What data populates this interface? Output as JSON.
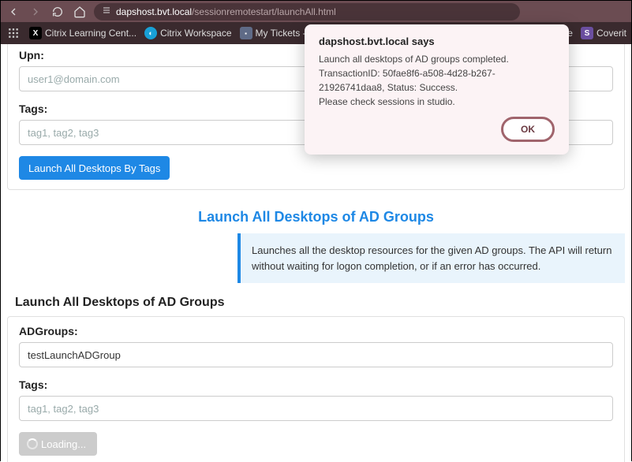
{
  "browser": {
    "url_domain": "dapshost.bvt.local",
    "url_path": "/sessionremotestart/launchAll.html"
  },
  "bookmarks": {
    "b1": "Citrix Learning Cent...",
    "b2": "Citrix Workspace",
    "b3": "My Tickets - Citrite...",
    "b4": "kstage",
    "b5": "Coverit"
  },
  "upn": {
    "label": "Upn:",
    "placeholder": "user1@domain.com"
  },
  "tags1": {
    "label": "Tags:",
    "placeholder": "tag1, tag2, tag3"
  },
  "btn_launch_tags": "Launch All Desktops By Tags",
  "section2_title": "Launch All Desktops of AD Groups",
  "section2_info": "Launches all the desktop resources for the given AD groups. The API will return without waiting for logon completion, or if an error has occurred.",
  "fieldset_title": "Launch All Desktops of AD Groups",
  "adgroups": {
    "label": "ADGroups:",
    "value": "testLaunchADGroup"
  },
  "tags2": {
    "label": "Tags:",
    "placeholder": "tag1, tag2, tag3"
  },
  "btn_loading": "Loading...",
  "alert": {
    "title": "dapshost.bvt.local says",
    "line1": "Launch all desktops of AD groups completed. TransactionID: 50fae8f6-a508-4d28-b267-21926741daa8, Status: Success.",
    "line2": "Please check sessions in studio.",
    "ok": "OK"
  }
}
